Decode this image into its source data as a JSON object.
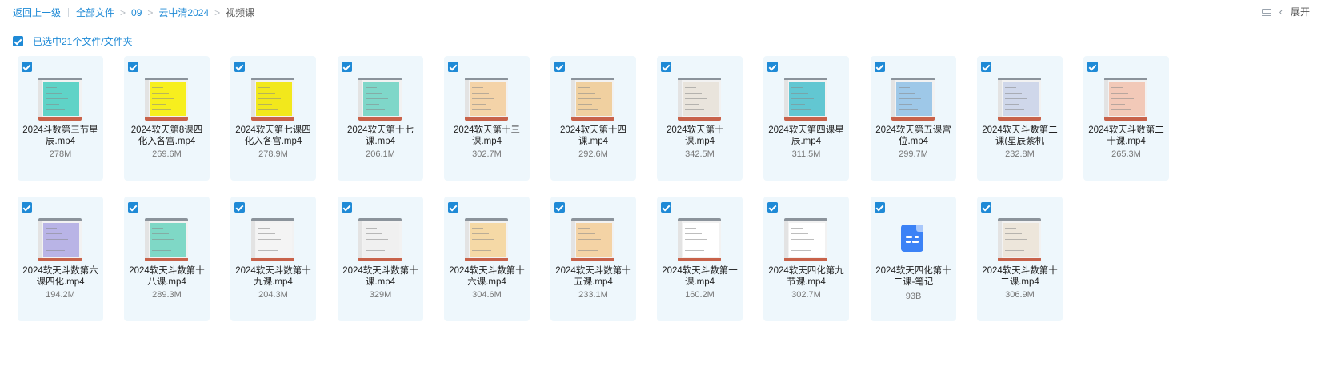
{
  "breadcrumb": {
    "back": "返回上一级",
    "items": [
      "全部文件",
      "09",
      "云中清2024"
    ],
    "current": "视频课"
  },
  "toolbar": {
    "expand_label": "展开",
    "list_icon": "list-view-icon",
    "chevron_icon": "chevron-left-icon"
  },
  "selection": {
    "label": "已选中21个文件/文件夹"
  },
  "colors": {
    "accent": "#1f8ad6",
    "card_bg": "#eef7fc"
  },
  "files": [
    {
      "name": "2024斗数第三节星辰.mp4",
      "size": "278M",
      "thumb": "#5fd3c7"
    },
    {
      "name": "2024软天第8课四化入各宫.mp4",
      "size": "269.6M",
      "thumb": "#f7ef1e"
    },
    {
      "name": "2024软天第七课四化入各宫.mp4",
      "size": "278.9M",
      "thumb": "#f2e81c"
    },
    {
      "name": "2024软天第十七课.mp4",
      "size": "206.1M",
      "thumb": "#7fd7c9"
    },
    {
      "name": "2024软天第十三课.mp4",
      "size": "302.7M",
      "thumb": "#f4d3a8"
    },
    {
      "name": "2024软天第十四课.mp4",
      "size": "292.6M",
      "thumb": "#f0d0a0"
    },
    {
      "name": "2024软天第十一课.mp4",
      "size": "342.5M",
      "thumb": "#e9e4dc"
    },
    {
      "name": "2024软天第四课星辰.mp4",
      "size": "311.5M",
      "thumb": "#62c7d2"
    },
    {
      "name": "2024软天第五课宫位.mp4",
      "size": "299.7M",
      "thumb": "#9ec8e8"
    },
    {
      "name": "2024软天斗数第二课(星辰紫机",
      "size": "232.8M",
      "thumb": "#cfd7ea"
    },
    {
      "name": "2024软天斗数第二十课.mp4",
      "size": "265.3M",
      "thumb": "#f2c9b8"
    },
    {
      "name": "2024软天斗数第六课四化.mp4",
      "size": "194.2M",
      "thumb": "#b9b4e6"
    },
    {
      "name": "2024软天斗数第十八课.mp4",
      "size": "289.3M",
      "thumb": "#7fd8c6"
    },
    {
      "name": "2024软天斗数第十九课.mp4",
      "size": "204.3M",
      "thumb": "#f4f4f4"
    },
    {
      "name": "2024软天斗数第十课.mp4",
      "size": "329M",
      "thumb": "#f0f0f0"
    },
    {
      "name": "2024软天斗数第十六课.mp4",
      "size": "304.6M",
      "thumb": "#f5d9a6"
    },
    {
      "name": "2024软天斗数第十五课.mp4",
      "size": "233.1M",
      "thumb": "#f4d3a5"
    },
    {
      "name": "2024软天斗数第一课.mp4",
      "size": "160.2M",
      "thumb": "#ffffff"
    },
    {
      "name": "2024软天四化第九节课.mp4",
      "size": "302.7M",
      "thumb": "#ffffff"
    },
    {
      "name": "2024软天四化第十二课-笔记",
      "size": "93B",
      "thumb": "note"
    },
    {
      "name": "2024软天斗数第十二课.mp4",
      "size": "306.9M",
      "thumb": "#ede6db"
    }
  ]
}
